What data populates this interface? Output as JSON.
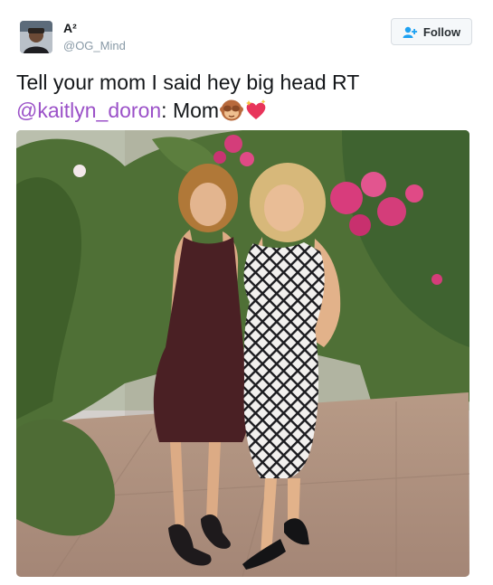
{
  "user": {
    "display_name": "A²",
    "handle": "@OG_Mind"
  },
  "follow": {
    "label": "Follow",
    "icon": "add-user-icon"
  },
  "tweet": {
    "text_line1": "Tell your mom I said hey big head RT",
    "mention": "@kaitlyn_doron",
    "text_after_mention": ": Mom",
    "emojis": [
      "see-no-evil-monkey-emoji",
      "sparkling-heart-emoji"
    ]
  },
  "photo": {
    "subject": "two-women-posing-in-garden"
  },
  "colors": {
    "mention": "#9b51c8",
    "handle": "#8899a6",
    "follow_icon": "#1da1f2"
  }
}
